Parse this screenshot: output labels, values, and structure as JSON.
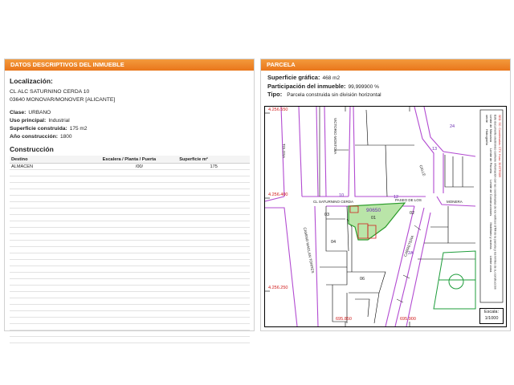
{
  "left": {
    "header_prefix": "DATOS DESCRIPTIVOS DEL ",
    "header_bold": "INMUEBLE",
    "localizacion_label": "Localización:",
    "address_line1": "CL ALC SATURNINO CERDA 10",
    "address_line2": "03640 MONOVAR/MONOVER [ALICANTE]",
    "clase_label": "Clase:",
    "clase_value": "URBANO",
    "uso_label": "Uso principal:",
    "uso_value": "Industrial",
    "superficie_label": "Superficie construida:",
    "superficie_value": "175 m2",
    "anio_label": "Año construcción:",
    "anio_value": "1800",
    "construccion_title": "Construcción",
    "table": {
      "headers": [
        "Destino",
        "Escalera / Planta / Puerta",
        "Superficie m²"
      ],
      "rows": [
        [
          "ALMACEN",
          "/00/",
          "175"
        ]
      ],
      "empty_rows": 27
    }
  },
  "right": {
    "header": "PARCELA",
    "superficie_grafica_label": "Superficie gráfica:",
    "superficie_grafica_value": "468 m2",
    "participacion_label": "Participación del inmueble:",
    "participacion_value": "99,999900 %",
    "tipo_label": "Tipo:",
    "tipo_value": "Parcela construida sin división horizontal",
    "map": {
      "coord_y1": "4.256.550",
      "coord_y2": "4.256.400",
      "coord_y3": "4.256.250",
      "coord_x1": "695.850",
      "coord_x2": "695.900",
      "street_top_left": "TOLOSA",
      "street_top_mid": "VICTORIO MONTOYA",
      "street_mid": "CL SATURNINO CERDA",
      "street_left_vertical": "CAMINO MACLAN TORRES",
      "street_right": "CALLE",
      "street_right2": "PASEO DE LOS",
      "street_right3": "MONERA",
      "street_bottom_right": "CARRETERA",
      "parcel_ref": "90650",
      "parcel_01": "01",
      "parcel_02": "02",
      "parcel_03": "03",
      "parcel_04": "04",
      "parcel_06": "06",
      "num_13": "13",
      "num_12": "12",
      "num_10": "10",
      "num_24": "24",
      "num_2A": "2A",
      "scale_label": "Escala:",
      "scale_value": "1/1000",
      "legend_items": [
        "Límite de Manzana",
        "Límite de Parcela",
        "Límite de Construcciones",
        "Mobiliario y aceras",
        "Límite zona verde",
        "Hidrografía"
      ],
      "side_text": "Este documento electrónico contiene información con las coordenadas de los vértices UTM de la parcela y los límites de su construcción",
      "side_text_red": "SED: SC: Coordenadas: CTV: Huso: 30 ETRS89"
    }
  }
}
